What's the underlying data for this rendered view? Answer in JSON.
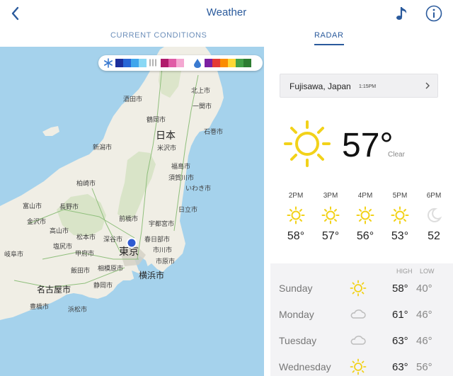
{
  "header": {
    "title": "Weather",
    "back_icon": "chevron-left-icon",
    "music_icon": "music-note-icon",
    "info_icon": "info-icon",
    "accent": "#2a5a9c"
  },
  "tabs": [
    {
      "label": "CURRENT CONDITIONS",
      "active": false
    },
    {
      "label": "RADAR",
      "active": true
    }
  ],
  "map": {
    "labels": [
      "酒田市",
      "北上市",
      "一関市",
      "鶴岡市",
      "日本",
      "石巻市",
      "新潟市",
      "米沢市",
      "福島市",
      "須賀川市",
      "柏崎市",
      "いわき市",
      "富山市",
      "長野市",
      "日立市",
      "金沢市",
      "高山市",
      "前橋市",
      "宇都宮市",
      "松本市",
      "深谷市",
      "春日部市",
      "塩尻市",
      "東京",
      "市川市",
      "岐阜市",
      "甲府市",
      "相模原市",
      "市原市",
      "飯田市",
      "横浜市",
      "名古屋市",
      "静岡市",
      "豊橋市",
      "浜松市"
    ],
    "legend_colors": [
      "#1c2f9c",
      "#2766d6",
      "#3fa6ec",
      "#8ad8f5",
      "#b01c6c",
      "#e05ba6",
      "#f4a8d2",
      "#7b1fa2",
      "#e53935",
      "#fb8c00",
      "#fdd835",
      "#43a047",
      "#2e7d32"
    ],
    "user_location_color": "#2f5bd1"
  },
  "current": {
    "location": "Fujisawa, Japan",
    "time": "1:15PM",
    "temp": "57°",
    "condition": "Clear",
    "icon": "sun-icon"
  },
  "hourly": [
    {
      "time": "2PM",
      "temp": "58°",
      "icon": "sun-icon"
    },
    {
      "time": "3PM",
      "temp": "57°",
      "icon": "sun-icon"
    },
    {
      "time": "4PM",
      "temp": "56°",
      "icon": "sun-icon"
    },
    {
      "time": "5PM",
      "temp": "53°",
      "icon": "sun-icon"
    },
    {
      "time": "6PM",
      "temp": "52",
      "icon": "moon-icon"
    }
  ],
  "daily": {
    "high_label": "HIGH",
    "low_label": "LOW",
    "days": [
      {
        "name": "Sunday",
        "icon": "sun-icon",
        "high": "58°",
        "low": "40°"
      },
      {
        "name": "Monday",
        "icon": "cloud-icon",
        "high": "61°",
        "low": "46°"
      },
      {
        "name": "Tuesday",
        "icon": "cloud-icon",
        "high": "63°",
        "low": "46°"
      },
      {
        "name": "Wednesday",
        "icon": "sun-icon",
        "high": "63°",
        "low": "56°"
      }
    ]
  }
}
